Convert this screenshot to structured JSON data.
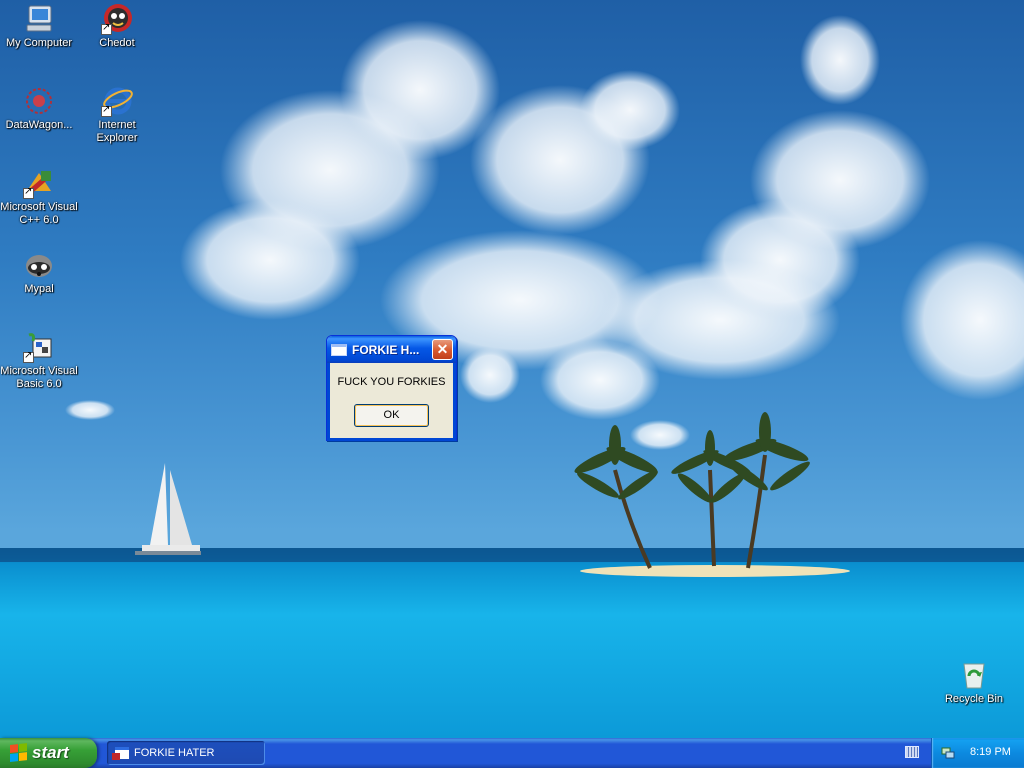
{
  "desktop": {
    "icons": [
      {
        "name": "my-computer",
        "label": "My Computer"
      },
      {
        "name": "chedot",
        "label": "Chedot"
      },
      {
        "name": "datawagon",
        "label": "DataWagon..."
      },
      {
        "name": "internet-explorer",
        "label": "Internet Explorer"
      },
      {
        "name": "ms-visual-cpp",
        "label": "Microsoft Visual C++ 6.0"
      },
      {
        "name": "mypal",
        "label": "Mypal"
      },
      {
        "name": "ms-visual-basic",
        "label": "Microsoft Visual Basic 6.0"
      },
      {
        "name": "recycle-bin",
        "label": "Recycle Bin"
      }
    ]
  },
  "dialog": {
    "title": "FORKIE H...",
    "message": "FUCK YOU FORKIES",
    "ok_label": "OK",
    "close_glyph": "✕"
  },
  "taskbar": {
    "start_label": "start",
    "task_label": "FORKIE HATER",
    "clock": "8:19 PM"
  },
  "colors": {
    "taskbar_blue": "#2157d7",
    "start_green": "#37a037",
    "tray_blue": "#0c8ae0",
    "dialog_face": "#ece9d8",
    "close_red": "#d8592e"
  }
}
